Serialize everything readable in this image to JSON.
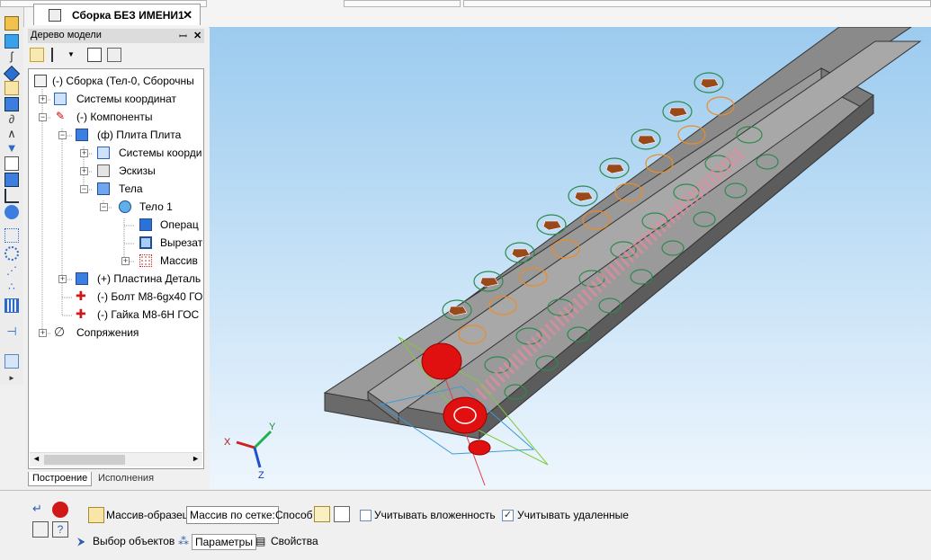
{
  "document_tab": {
    "title": "Сборка БЕЗ ИМЕНИ1",
    "close": "✕"
  },
  "tree_panel": {
    "title": "Дерево модели",
    "pin": "ꟷ",
    "close": "✕",
    "nodes": [
      {
        "label": "(-) Сборка (Тел-0, Сборочны",
        "icon": "assembly-icon"
      },
      {
        "label": "Системы координат",
        "icon": "coordinate-system-icon"
      },
      {
        "label": "(-) Компоненты",
        "icon": "components-icon"
      },
      {
        "label": "(ф) Плита Плита",
        "icon": "part-icon"
      },
      {
        "label": "Системы коорди",
        "icon": "coordinate-system-icon"
      },
      {
        "label": "Эскизы",
        "icon": "sketch-icon"
      },
      {
        "label": "Тела",
        "icon": "bodies-icon"
      },
      {
        "label": "Тело 1",
        "icon": "body-icon"
      },
      {
        "label": "Операц",
        "icon": "extrude-icon"
      },
      {
        "label": "Вырезат",
        "icon": "cut-icon"
      },
      {
        "label": "Массив",
        "icon": "pattern-icon"
      },
      {
        "label": "(+) Пластина Деталь",
        "icon": "part-icon"
      },
      {
        "label": "(-) Болт М8-6gx40 ГО",
        "icon": "standard-part-icon"
      },
      {
        "label": "(-) Гайка М8-6Н ГОС",
        "icon": "standard-part-icon"
      },
      {
        "label": "Сопряжения",
        "icon": "mates-icon"
      }
    ],
    "tabs": [
      "Построение",
      "Исполнения"
    ]
  },
  "triad": {
    "x": "X",
    "y": "Y",
    "z": "Z"
  },
  "properties": {
    "sample_button": "Массив-образец",
    "pattern_type_value": "Массив по сетке:",
    "method_label": "Способ",
    "consider_nested_label": "Учитывать вложенность",
    "consider_nested_checked": false,
    "consider_deleted_label": "Учитывать удаленные",
    "consider_deleted_checked": true,
    "tabs": [
      "Выбор объектов",
      "Параметры",
      "Свойства"
    ],
    "active_tab": "Параметры"
  },
  "colors": {
    "accent": "#3b6fc8",
    "viewport_top": "#9ccbef",
    "selection_red": "#e01010",
    "preview_orange": "#f08a20"
  }
}
